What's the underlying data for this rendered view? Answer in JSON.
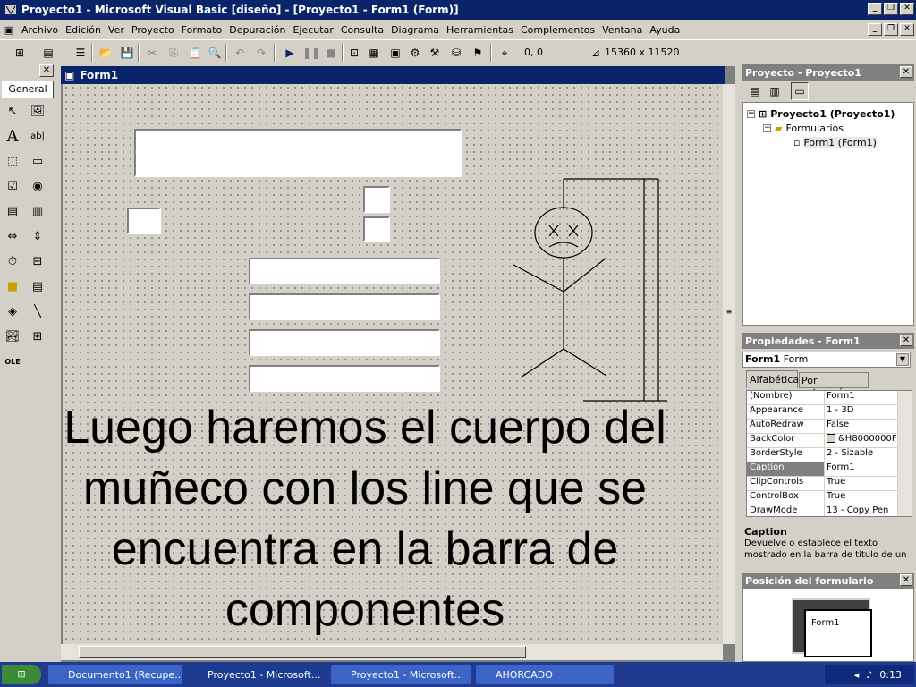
{
  "window": {
    "title": "Proyecto1 - Microsoft Visual Basic [diseño] - [Proyecto1 - Form1 (Form)]"
  },
  "menu": [
    "Archivo",
    "Edición",
    "Ver",
    "Proyecto",
    "Formato",
    "Depuración",
    "Ejecutar",
    "Consulta",
    "Diagrama",
    "Herramientas",
    "Complementos",
    "Ventana",
    "Ayuda"
  ],
  "toolbar": {
    "position_readout": "0, 0",
    "size_readout": "15360 x 11520"
  },
  "toolbox": {
    "tab_label": "General"
  },
  "form": {
    "title": "Form1"
  },
  "overlay_caption": "Luego haremos el cuerpo del muñeco con los line que se encuentra en la barra de componentes",
  "project_pane": {
    "title": "Proyecto - Proyecto1",
    "tree": {
      "root": "Proyecto1 (Proyecto1)",
      "folder": "Formularios",
      "form": "Form1 (Form1)"
    }
  },
  "properties_pane": {
    "title": "Propiedades - Form1",
    "object_name": "Form1",
    "object_type": "Form",
    "tabs": [
      "Alfabética",
      "Por categorías"
    ],
    "rows": [
      {
        "name": "(Nombre)",
        "value": "Form1"
      },
      {
        "name": "Appearance",
        "value": "1 - 3D"
      },
      {
        "name": "AutoRedraw",
        "value": "False"
      },
      {
        "name": "BackColor",
        "value": "&H8000000F"
      },
      {
        "name": "BorderStyle",
        "value": "2 - Sizable"
      },
      {
        "name": "Caption",
        "value": "Form1"
      },
      {
        "name": "ClipControls",
        "value": "True"
      },
      {
        "name": "ControlBox",
        "value": "True"
      },
      {
        "name": "DrawMode",
        "value": "13 - Copy Pen"
      }
    ],
    "description_title": "Caption",
    "description_text": "Devuelve o establece el texto mostrado en la barra de título de un"
  },
  "position_pane": {
    "title": "Posición del formulario",
    "preview_label": "Form1"
  },
  "taskbar": {
    "tasks": [
      "Documento1 (Recupe...",
      "Proyecto1 - Microsoft...",
      "Proyecto1 - Microsoft...",
      "AHORCADO"
    ],
    "clock": "0:13"
  }
}
